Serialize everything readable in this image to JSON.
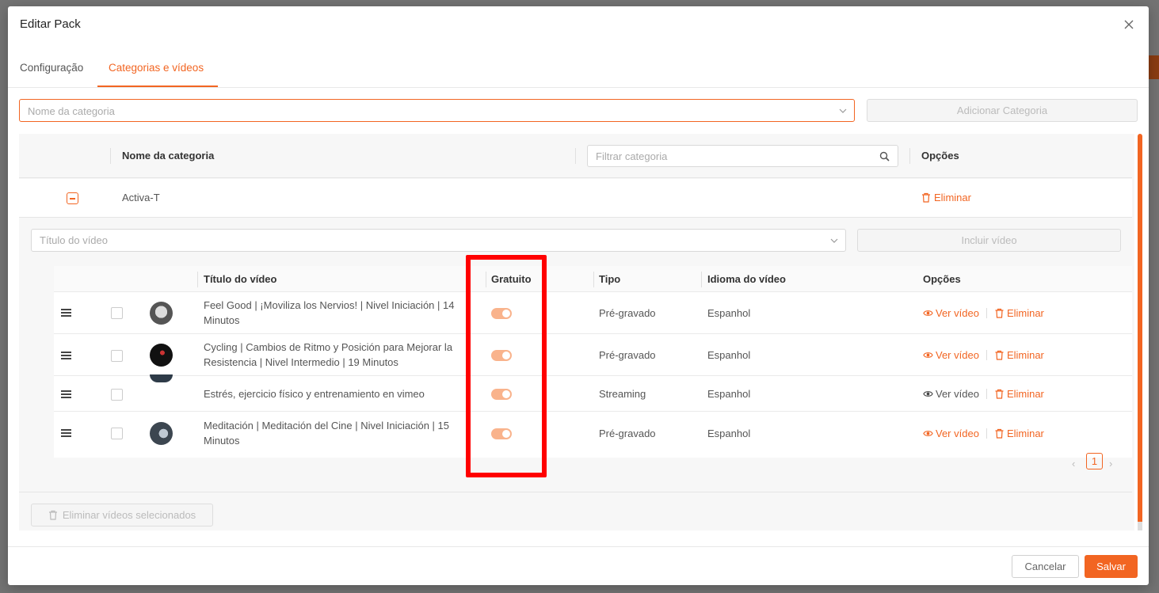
{
  "modal": {
    "title": "Editar Pack",
    "tabs": [
      {
        "label": "Configuração"
      },
      {
        "label": "Categorias e vídeos"
      }
    ],
    "active_tab": "Categorias e vídeos"
  },
  "category_select": {
    "placeholder": "Nome da categoria"
  },
  "add_category_label": "Adicionar Categoria",
  "category_table": {
    "headers": {
      "name": "Nome da categoria",
      "options": "Opções"
    },
    "filter_placeholder": "Filtrar categoria",
    "rows": [
      {
        "name": "Activa-T",
        "delete_label": "Eliminar"
      }
    ]
  },
  "video_select": {
    "placeholder": "Título do vídeo"
  },
  "include_video_label": "Incluir vídeo",
  "video_table": {
    "headers": {
      "title": "Título do vídeo",
      "free": "Gratuito",
      "type": "Tipo",
      "language": "Idioma do vídeo",
      "options": "Opções"
    },
    "rows": [
      {
        "title": "Feel Good | ¡Moviliza los Nervios! | Nivel Iniciación | 14 Minutos",
        "free": true,
        "type": "Pré-gravado",
        "language": "Espanhol",
        "view_label": "Ver vídeo",
        "delete_label": "Eliminar",
        "view_active": true
      },
      {
        "title": "Cycling | Cambios de Ritmo y Posición para Mejorar la Resistencia | Nivel Intermedio | 19 Minutos",
        "free": true,
        "type": "Pré-gravado",
        "language": "Espanhol",
        "view_label": "Ver vídeo",
        "delete_label": "Eliminar",
        "view_active": true
      },
      {
        "title": "Estrés, ejercicio físico y entrenamiento en vimeo",
        "free": true,
        "type": "Streaming",
        "language": "Espanhol",
        "view_label": "Ver vídeo",
        "delete_label": "Eliminar",
        "view_active": false
      },
      {
        "title": "Meditación | Meditación del Cine | Nivel Iniciación | 15 Minutos",
        "free": true,
        "type": "Pré-gravado",
        "language": "Espanhol",
        "view_label": "Ver vídeo",
        "delete_label": "Eliminar",
        "view_active": true
      }
    ]
  },
  "pagination": {
    "current_page": "1"
  },
  "bulk_delete_label": "Eliminar vídeos selecionados",
  "footer": {
    "cancel_label": "Cancelar",
    "save_label": "Salvar"
  },
  "colors": {
    "accent": "#f26522",
    "highlight": "#ff0000",
    "toggle_on": "#f9b38c"
  }
}
